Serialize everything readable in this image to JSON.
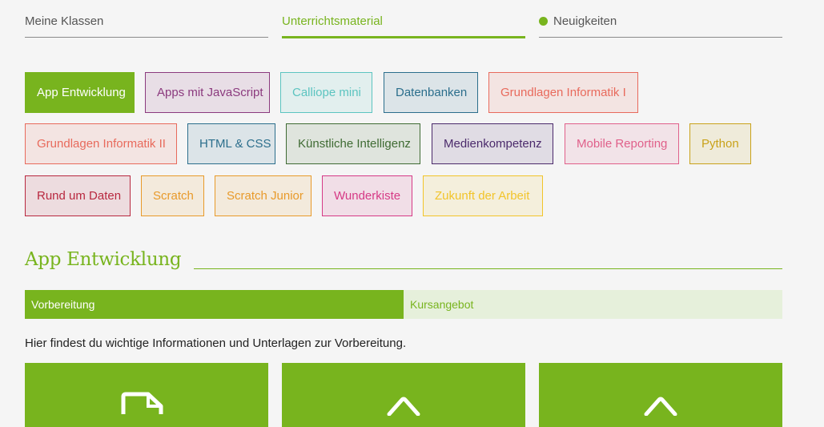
{
  "nav": {
    "tabs": [
      {
        "label": "Meine Klassen"
      },
      {
        "label": "Unterrichtsmaterial"
      },
      {
        "label": "Neuigkeiten"
      }
    ]
  },
  "courses": [
    {
      "label": "App Entwicklung",
      "color": "#78b41e",
      "selected": true
    },
    {
      "label": "Apps mit JavaScript",
      "color": "#8b3a7e"
    },
    {
      "label": "Calliope mini",
      "color": "#5cc4c0"
    },
    {
      "label": "Datenbanken",
      "color": "#2b6e8c"
    },
    {
      "label": "Grundlagen Informatik I",
      "color": "#e86a5c"
    },
    {
      "label": "Grundlagen Informatik II",
      "color": "#e86a5c"
    },
    {
      "label": "HTML & CSS",
      "color": "#2b6e8c"
    },
    {
      "label": "Künstliche Intelligenz",
      "color": "#3f6b33"
    },
    {
      "label": "Medienkompetenz",
      "color": "#4b2a6b"
    },
    {
      "label": "Mobile Reporting",
      "color": "#e0608a"
    },
    {
      "label": "Python",
      "color": "#c9a21a"
    },
    {
      "label": "Rund um Daten",
      "color": "#b8283f"
    },
    {
      "label": "Scratch",
      "color": "#e89a2a"
    },
    {
      "label": "Scratch Junior",
      "color": "#e89a2a"
    },
    {
      "label": "Wunderkiste",
      "color": "#d63a86"
    },
    {
      "label": "Zukunft der Arbeit",
      "color": "#f2c42a"
    }
  ],
  "section": {
    "title": "App Entwicklung",
    "subtabs": [
      {
        "label": "Vorbereitung"
      },
      {
        "label": "Kursangebot"
      }
    ],
    "intro": "Hier findest du wichtige Informationen und Unterlagen zur Vorbereitung."
  },
  "cards": [
    {
      "icon": "document-icon"
    },
    {
      "icon": "tag-icon"
    },
    {
      "icon": "tag-icon"
    }
  ],
  "colors": {
    "accent": "#78b41e",
    "accent_light": "#e6f0db"
  }
}
